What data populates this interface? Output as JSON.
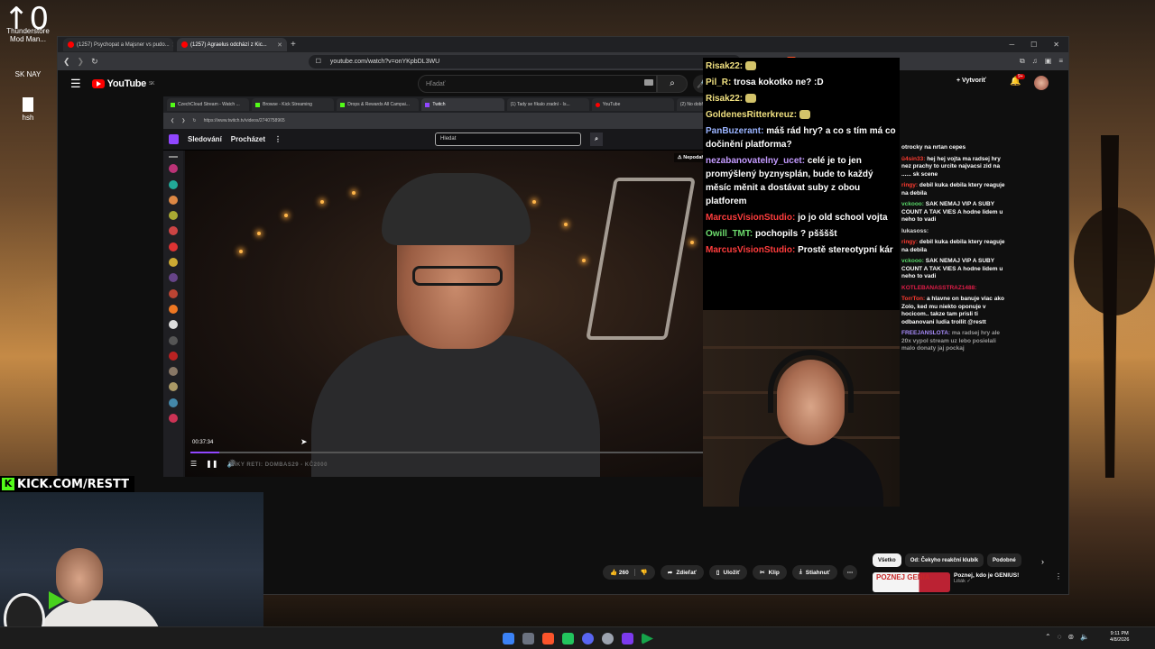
{
  "desktop": {
    "top_left_counter": "0",
    "icons": [
      {
        "label": "Thunderstore Mod Man..."
      },
      {
        "label": "SK NAY"
      },
      {
        "label": "hsh"
      }
    ]
  },
  "browser": {
    "tabs": [
      {
        "label": "(1257) Psychopat a Majsner vs pudo..."
      },
      {
        "label": "(1257) Agraelus odchází z Kic..."
      }
    ],
    "url": "youtube.com/watch?v=onYKpbDL3WU"
  },
  "youtube": {
    "logo": "YouTube",
    "logo_region": "SK",
    "search_placeholder": "Hľadať",
    "create_label": "Vytvoriť",
    "notifications_badge": "9+",
    "actions": {
      "likes": "260",
      "share": "Zdieľať",
      "save": "Uložiť",
      "clip": "Klip",
      "download": "Stiahnuť"
    },
    "chips": [
      "Všetko",
      "Od: Čekyho reakční klubík",
      "Podobné"
    ],
    "recommendation": {
      "thumb_text": "POZNEJ GENIA",
      "title": "Poznej, kdo je GENIUS!",
      "channel": "Lišák"
    }
  },
  "inner_browser": {
    "tabs": [
      "CzechCloud Stream - Watch ...",
      "Browse - Kick Streaming",
      "Drops & Rewards All Campai...",
      "Twitch",
      "(1) Tady se říkalo zradní - Is...",
      "YouTube",
      "(2) No dobře, tak si o tom..."
    ],
    "url": "https://www.twitch.tv/videos/2740758965"
  },
  "twitch": {
    "nav_following": "Sledování",
    "nav_browse": "Procházet",
    "search_placeholder": "Hledat",
    "warning": "Nepodařilo se zjistit klasifikaci",
    "timestamp": "00:37:34",
    "ticker": "DIKY RETI: DOMBAS29 - KČ2000",
    "progress": 0.05
  },
  "chat_overlay": [
    {
      "name": "Risak22:",
      "text": "",
      "color": "yellow"
    },
    {
      "name": "Pil_R:",
      "text": "trosa kokotko ne? :D",
      "color": "yellow"
    },
    {
      "name": "Risak22:",
      "text": "",
      "color": "yellow"
    },
    {
      "name": "GoldenesRitterkreuz:",
      "text": "",
      "color": "yellow"
    },
    {
      "name": "PanBuzerant:",
      "text": "máš rád hry? a co s tím má co dočinění platforma?",
      "color": "blue"
    },
    {
      "name": "nezabanovatelny_ucet:",
      "text": "celé je to jen promýšlený byznysplán, bude to každý měsíc měnit a dostávat suby z obou platforem",
      "color": "purple"
    },
    {
      "name": "MarcusVisionStudio:",
      "text": "jo jo old school vojta",
      "color": "red"
    },
    {
      "name": "Owill_TMT:",
      "text": "pochopils ? pššššt",
      "color": "green"
    },
    {
      "name": "MarcusVisionStudio:",
      "text": "Prostě stereotypní kár",
      "color": "red"
    }
  ],
  "side_chat": [
    {
      "name": "",
      "text": "otrocky na nrtan cepes",
      "style": "gray"
    },
    {
      "name": "ü4sin33:",
      "text": "hej hej vojta ma radsej hry nez prachy to urcite najvacsi zid na ...... sk scene",
      "style": "red"
    },
    {
      "name": "ringy:",
      "text": "debil kuka debila ktery reaguje na debila",
      "style": "red"
    },
    {
      "name": "vckooo:",
      "text": "SAK NEMAJ VIP A SUBY COUNT A TAK VIES A hodne lidem u neho to vadi",
      "style": "green"
    },
    {
      "name": "lukasoss:",
      "text": "",
      "style": "gray"
    },
    {
      "name": "ringy:",
      "text": "debil kuka debila ktery reaguje na debila",
      "style": "red"
    },
    {
      "name": "vckooo:",
      "text": "SAK NEMAJ VIP A SUBY COUNT A TAK VIES A hodne lidem u neho to vadi",
      "style": "green"
    },
    {
      "name": "KOTLEBANASSTRAZ1488:",
      "text": "",
      "style": "pink"
    },
    {
      "name": "TorrTon:",
      "text": "a hlavne on banuje viac ako Zolo, ked mu niekto oponuje v hocicom.. takze tam prisli ti odbanovani ludia trollit @restt",
      "style": "red"
    },
    {
      "name": "FREEJANSLOTA:",
      "text": "ma radsej hry ale 20x vypol stream uz lebo posielali malo donaty jaj pockaj",
      "style": "purple"
    }
  ],
  "overlay": {
    "kick_label": "KICK.COM/RESTT"
  },
  "taskbar": {
    "time": "9:11 PM",
    "date": "4/8/2026"
  }
}
